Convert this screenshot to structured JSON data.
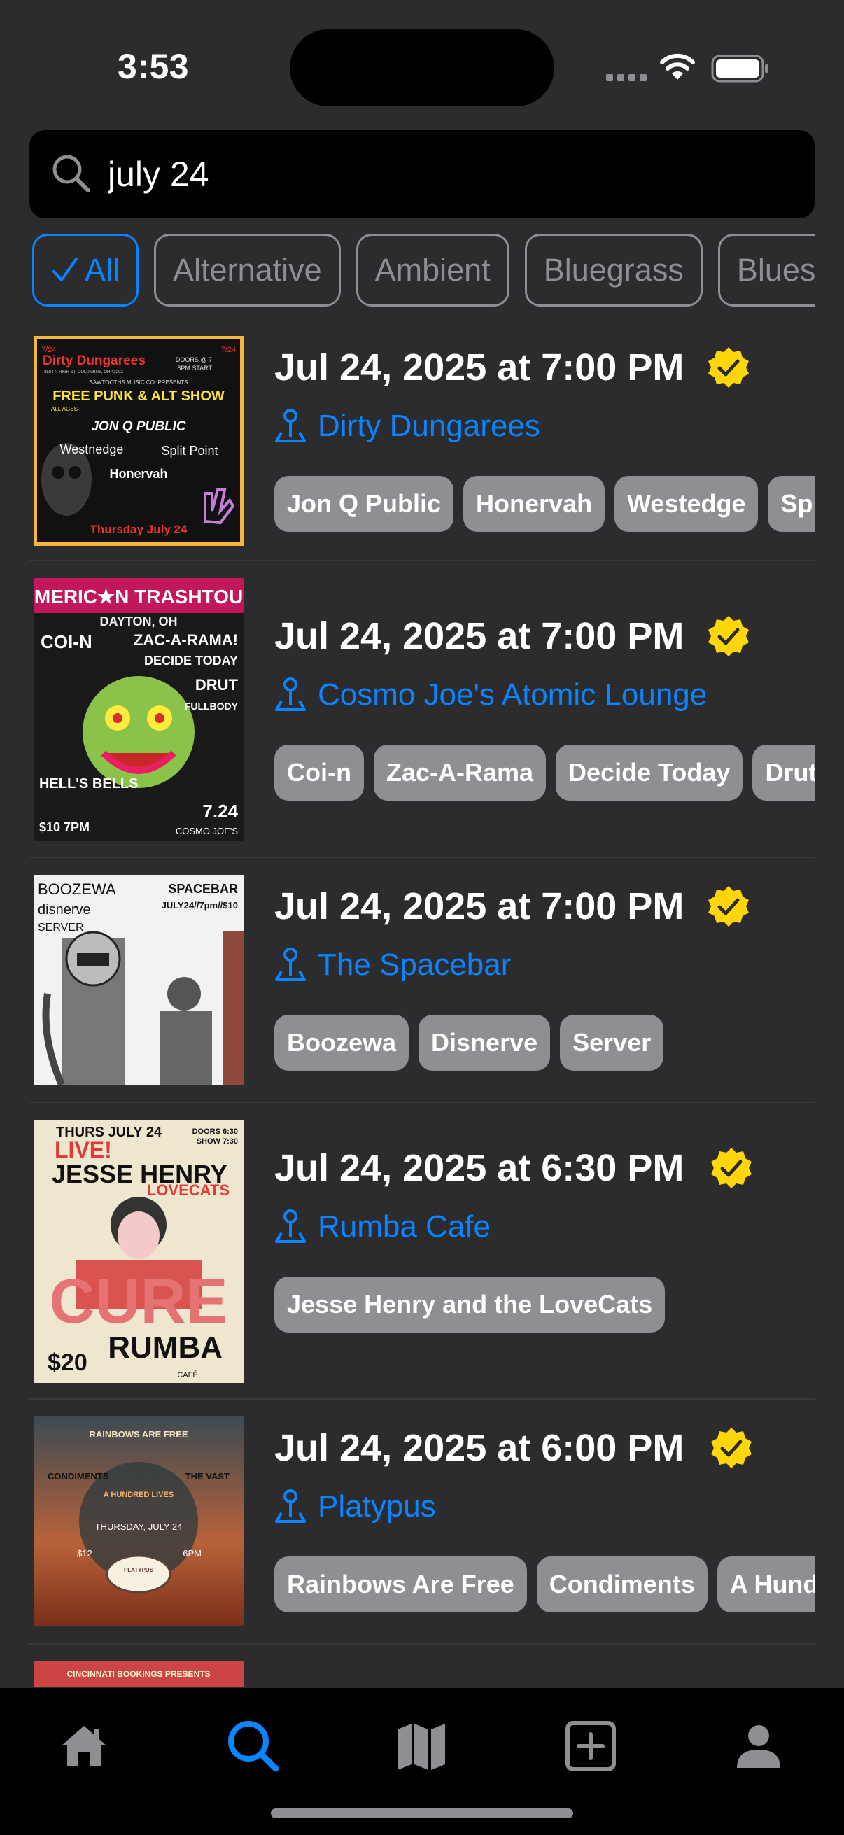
{
  "status_bar": {
    "time": "3:53"
  },
  "search": {
    "value": "july 24",
    "placeholder": ""
  },
  "filters": [
    {
      "label": "All",
      "active": true
    },
    {
      "label": "Alternative",
      "active": false
    },
    {
      "label": "Ambient",
      "active": false
    },
    {
      "label": "Bluegrass",
      "active": false
    },
    {
      "label": "Blues",
      "active": false
    }
  ],
  "events": [
    {
      "date": "Jul 24, 2025 at 7:00 PM",
      "venue": "Dirty Dungarees",
      "artists": [
        "Jon Q Public",
        "Honervah",
        "Westedge",
        "Split Point"
      ],
      "poster": {
        "headline": "Dirty Dungarees",
        "date_left": "7/24",
        "date_right": "7/24",
        "doors": "DOORS @ 7",
        "start": "8PM START",
        "address": "2584 N HIGH ST, COLUMBUS, OH 43202",
        "presenter": "SAWTOOTHS MUSIC CO. PRESENTS",
        "title": "FREE PUNK & ALT SHOW",
        "ages": "ALL AGES",
        "bands": [
          "JON Q PUBLIC",
          "Westnedge",
          "Split Point",
          "Honervah"
        ],
        "footer": "Thursday July 24"
      }
    },
    {
      "date": "Jul 24, 2025 at 7:00 PM",
      "venue": "Cosmo Joe's Atomic Lounge",
      "artists": [
        "Coi-n",
        "Zac-A-Rama",
        "Decide Today",
        "Drut"
      ],
      "poster": {
        "headline": "AMERIC★N TRASHTOUR",
        "city": "DAYTON, OH",
        "bands": [
          "COI-N",
          "ZAC-A-RAMA!",
          "DECIDE TODAY",
          "DRUT",
          "FULLBODY",
          "HELL'S BELLS"
        ],
        "price": "$10 7PM",
        "date": "7.24",
        "venue": "COSMO JOE'S"
      }
    },
    {
      "date": "Jul 24, 2025 at 7:00 PM",
      "venue": "The Spacebar",
      "artists": [
        "Boozewa",
        "Disnerve",
        "Server"
      ],
      "poster": {
        "bands": [
          "BOOZEWA",
          "disnerve",
          "SERVER"
        ],
        "venue": "SPACEBAR",
        "info": "JULY24//7pm//$10"
      }
    },
    {
      "date": "Jul 24, 2025 at 6:30 PM",
      "venue": "Rumba Cafe",
      "artists": [
        "Jesse Henry and the LoveCats"
      ],
      "poster": {
        "date": "THURS JULY 24",
        "doors": "DOORS 6:30",
        "show": "SHOW 7:30",
        "live": "LIVE!",
        "name": "JESSE HENRY",
        "band": "LOVECATS",
        "tribute": "CURE",
        "price": "$20",
        "venue": "RUMBA",
        "cafe": "CAFÉ"
      }
    },
    {
      "date": "Jul 24, 2025 at 6:00 PM",
      "venue": "Platypus",
      "artists": [
        "Rainbows Are Free",
        "Condiments",
        "A Hundred Lives"
      ],
      "poster": {
        "headline": "RAINBOWS ARE FREE",
        "left": "CONDIMENTS",
        "right": "THE VAST",
        "middle": "A HUNDRED LIVES",
        "date": "THURSDAY, JULY 24",
        "price": "$12",
        "time": "6PM",
        "badge": "PLATYPUS"
      }
    },
    {
      "poster": {
        "headline": "CINCINNATI BOOKINGS PRESENTS"
      }
    }
  ],
  "tabs": [
    {
      "icon": "home-icon",
      "active": false
    },
    {
      "icon": "search-icon",
      "active": true
    },
    {
      "icon": "map-icon",
      "active": false
    },
    {
      "icon": "add-icon",
      "active": false
    },
    {
      "icon": "profile-icon",
      "active": false
    }
  ],
  "colors": {
    "accent": "#0a84ff",
    "verified": "#ffd60a",
    "background": "#2c2c2e",
    "tag": "#8e8e93"
  }
}
